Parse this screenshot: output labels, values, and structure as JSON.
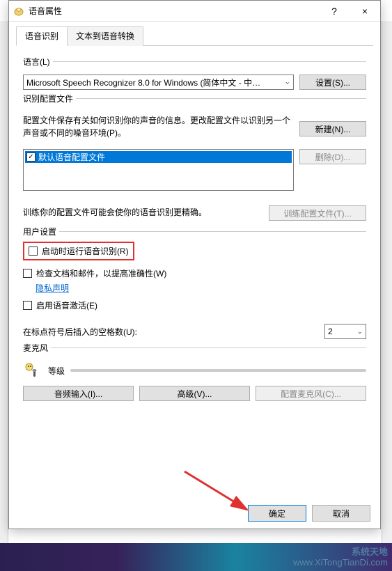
{
  "window": {
    "title": "语音属性",
    "help_label": "?",
    "close_label": "×"
  },
  "tabs": {
    "active": "语音识别",
    "inactive": "文本到语音转换"
  },
  "language_group": {
    "legend": "语言(L)",
    "selected": "Microsoft Speech Recognizer 8.0 for Windows (简体中文 - 中…",
    "settings_btn": "设置(S)..."
  },
  "profile_group": {
    "legend": "识别配置文件",
    "desc": "配置文件保存有关如何识别你的声音的信息。更改配置文件以识别另一个声音或不同的噪音环境(P)。",
    "new_btn": "新建(N)...",
    "delete_btn": "删除(D)...",
    "item_label": "默认语音配置文件",
    "item_checked": true,
    "train_desc": "训练你的配置文件可能会使你的语音识别更精确。",
    "train_btn": "训练配置文件(T)..."
  },
  "user_group": {
    "legend": "用户设置",
    "run_at_startup": "启动时运行语音识别(R)",
    "check_docs": "检查文档和邮件，以提高准确性(W)",
    "privacy_link": "隐私声明",
    "enable_activation": "启用语音激活(E)",
    "spaces_label": "在标点符号后插入的空格数(U):",
    "spaces_value": "2"
  },
  "mic_group": {
    "legend": "麦克风",
    "level_label": "等级",
    "audio_input_btn": "音频输入(I)...",
    "advanced_btn": "高级(V)...",
    "config_mic_btn": "配置麦克风(C)..."
  },
  "dialog_buttons": {
    "ok": "确定",
    "cancel": "取消"
  },
  "watermark": {
    "line1": "系统天地",
    "line2": "www.XiTongTianDi.com"
  }
}
